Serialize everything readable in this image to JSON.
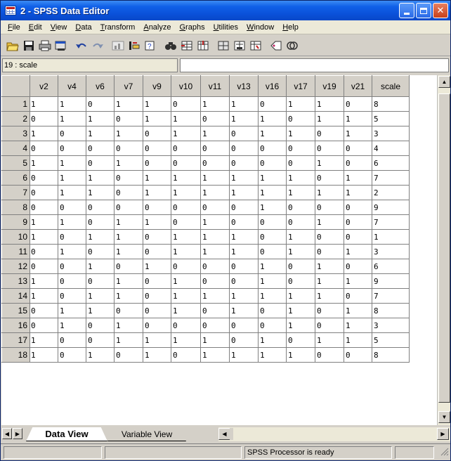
{
  "window": {
    "title": "2 - SPSS Data Editor"
  },
  "menu": [
    "File",
    "Edit",
    "View",
    "Data",
    "Transform",
    "Analyze",
    "Graphs",
    "Utilities",
    "Window",
    "Help"
  ],
  "toolbar": {
    "icons": [
      "open-icon",
      "save-icon",
      "print-icon",
      "dialog-recall-icon",
      "undo-icon",
      "redo-icon",
      "goto-chart-icon",
      "goto-case-icon",
      "variables-icon",
      "find-icon",
      "insert-cases-icon",
      "insert-variable-icon",
      "split-file-icon",
      "weight-cases-icon",
      "select-cases-icon",
      "value-labels-icon",
      "use-sets-icon"
    ]
  },
  "cell_editor": {
    "reference": "19 : scale",
    "value": ""
  },
  "grid": {
    "columns": [
      "v2",
      "v4",
      "v6",
      "v7",
      "v9",
      "v10",
      "v11",
      "v13",
      "v16",
      "v17",
      "v19",
      "v21",
      "scale"
    ],
    "rows": [
      [
        "1",
        "1",
        "0",
        "1",
        "1",
        "0",
        "1",
        "1",
        "0",
        "1",
        "1",
        "0",
        "8"
      ],
      [
        "0",
        "1",
        "1",
        "0",
        "1",
        "1",
        "0",
        "1",
        "1",
        "0",
        "1",
        "1",
        "5"
      ],
      [
        "1",
        "0",
        "1",
        "1",
        "0",
        "1",
        "1",
        "0",
        "1",
        "1",
        "0",
        "1",
        "3"
      ],
      [
        "0",
        "0",
        "0",
        "0",
        "0",
        "0",
        "0",
        "0",
        "0",
        "0",
        "0",
        "0",
        "4"
      ],
      [
        "1",
        "1",
        "0",
        "1",
        "0",
        "0",
        "0",
        "0",
        "0",
        "0",
        "1",
        "0",
        "6"
      ],
      [
        "0",
        "1",
        "1",
        "0",
        "1",
        "1",
        "1",
        "1",
        "1",
        "1",
        "0",
        "1",
        "7"
      ],
      [
        "0",
        "1",
        "1",
        "0",
        "1",
        "1",
        "1",
        "1",
        "1",
        "1",
        "1",
        "1",
        "2"
      ],
      [
        "0",
        "0",
        "0",
        "0",
        "0",
        "0",
        "0",
        "0",
        "1",
        "0",
        "0",
        "0",
        "9"
      ],
      [
        "1",
        "1",
        "0",
        "1",
        "1",
        "0",
        "1",
        "0",
        "0",
        "0",
        "1",
        "0",
        "7"
      ],
      [
        "1",
        "0",
        "1",
        "1",
        "0",
        "1",
        "1",
        "1",
        "0",
        "1",
        "0",
        "0",
        "1"
      ],
      [
        "0",
        "1",
        "0",
        "1",
        "0",
        "1",
        "1",
        "1",
        "0",
        "1",
        "0",
        "1",
        "3"
      ],
      [
        "0",
        "0",
        "1",
        "0",
        "1",
        "0",
        "0",
        "0",
        "1",
        "0",
        "1",
        "0",
        "6"
      ],
      [
        "1",
        "0",
        "0",
        "1",
        "0",
        "1",
        "0",
        "0",
        "1",
        "0",
        "1",
        "1",
        "9"
      ],
      [
        "1",
        "0",
        "1",
        "1",
        "0",
        "1",
        "1",
        "1",
        "1",
        "1",
        "1",
        "0",
        "7"
      ],
      [
        "0",
        "1",
        "1",
        "0",
        "0",
        "1",
        "0",
        "1",
        "0",
        "1",
        "0",
        "1",
        "8"
      ],
      [
        "0",
        "1",
        "0",
        "1",
        "0",
        "0",
        "0",
        "0",
        "0",
        "1",
        "0",
        "1",
        "3"
      ],
      [
        "1",
        "0",
        "0",
        "1",
        "1",
        "1",
        "1",
        "0",
        "1",
        "0",
        "1",
        "1",
        "5"
      ],
      [
        "1",
        "0",
        "1",
        "0",
        "1",
        "0",
        "1",
        "1",
        "1",
        "1",
        "0",
        "0",
        "8"
      ]
    ]
  },
  "tabs": {
    "active": "Data View",
    "inactive": "Variable View"
  },
  "status": {
    "message": "SPSS Processor  is ready"
  }
}
